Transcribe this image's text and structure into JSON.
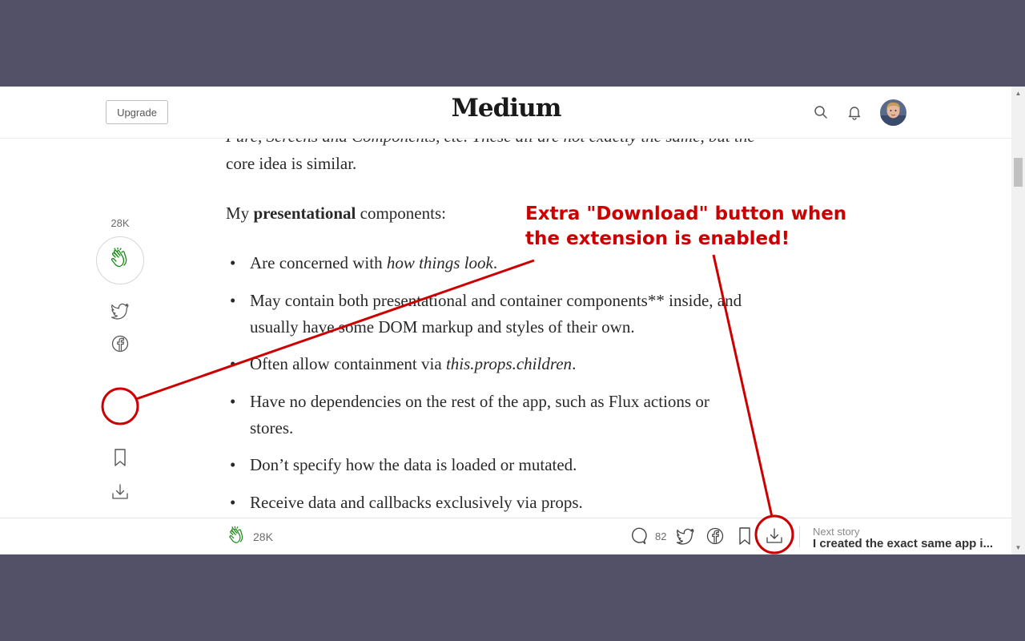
{
  "header": {
    "upgrade_label": "Upgrade",
    "logo": "Medium",
    "icons": [
      "search-icon",
      "bell-icon"
    ],
    "avatar": "user-avatar"
  },
  "article": {
    "cut_line": "Pure, Screens and Components, etc. These all are not exactly the same, but the",
    "para1": "core idea is similar.",
    "para2_prefix": "My ",
    "para2_bold": "presentational",
    "para2_suffix": " components:",
    "list": [
      {
        "prefix": "Are concerned with ",
        "italic": "how things look",
        "suffix": "."
      },
      {
        "line1": "May contain both presentational and container components** inside, and",
        "line2": "usually have some DOM markup and styles of their own."
      },
      {
        "prefix": "Often allow containment via ",
        "italic": "this.props.children",
        "suffix": "."
      },
      {
        "line1": "Have no dependencies on the rest of the app, such as Flux actions or",
        "line2": "stores."
      },
      {
        "text": "Don’t specify how the data is loaded or mutated."
      },
      {
        "text": "Receive data and callbacks exclusively via props."
      }
    ]
  },
  "left_rail": {
    "clap_count": "28K",
    "icons": [
      "clap-icon",
      "twitter-icon",
      "facebook-icon",
      "bookmark-icon",
      "download-icon"
    ]
  },
  "bottom_bar": {
    "clap_count": "28K",
    "comment_count": "82",
    "icons": [
      "clap-icon",
      "comment-icon",
      "twitter-icon",
      "facebook-icon",
      "bookmark-icon",
      "download-icon"
    ],
    "next_label": "Next story",
    "next_title": "I created the exact same app i..."
  },
  "annotation": {
    "line1": "Extra \"Download\" button when",
    "line2": "the extension is enabled!",
    "color": "#cc0000"
  },
  "colors": {
    "backdrop": "#535167",
    "clap_green": "#1a8917",
    "text": "#292929"
  }
}
